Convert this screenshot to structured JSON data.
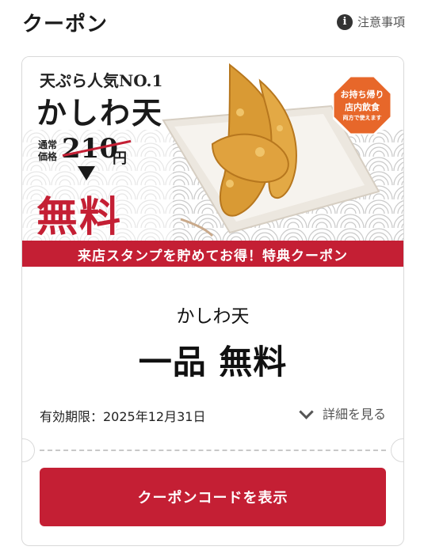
{
  "header": {
    "title": "クーポン",
    "notes_label": "注意事項",
    "notes_icon": "info-icon"
  },
  "banner": {
    "tagline": "天ぷら人気NO.1",
    "product_name": "かしわ天",
    "regular_price_label": "通常価格",
    "regular_price": "210",
    "price_unit": "円",
    "free_text": "無料",
    "badge": {
      "line1": "お持ち帰り",
      "line2": "店内飲食",
      "line3": "両方で使えます"
    },
    "strip_text": "来店スタンプを貯めてお得！特典クーポン"
  },
  "coupon": {
    "item_name": "かしわ天",
    "offer": "一品 無料",
    "expiry": "有効期限：2025年12月31日",
    "details_label": "詳細を見る"
  },
  "cta": {
    "label": "クーポンコードを表示"
  },
  "colors": {
    "accent": "#c41f34",
    "badge": "#e7672a",
    "pattern": "#c9c9c9"
  }
}
